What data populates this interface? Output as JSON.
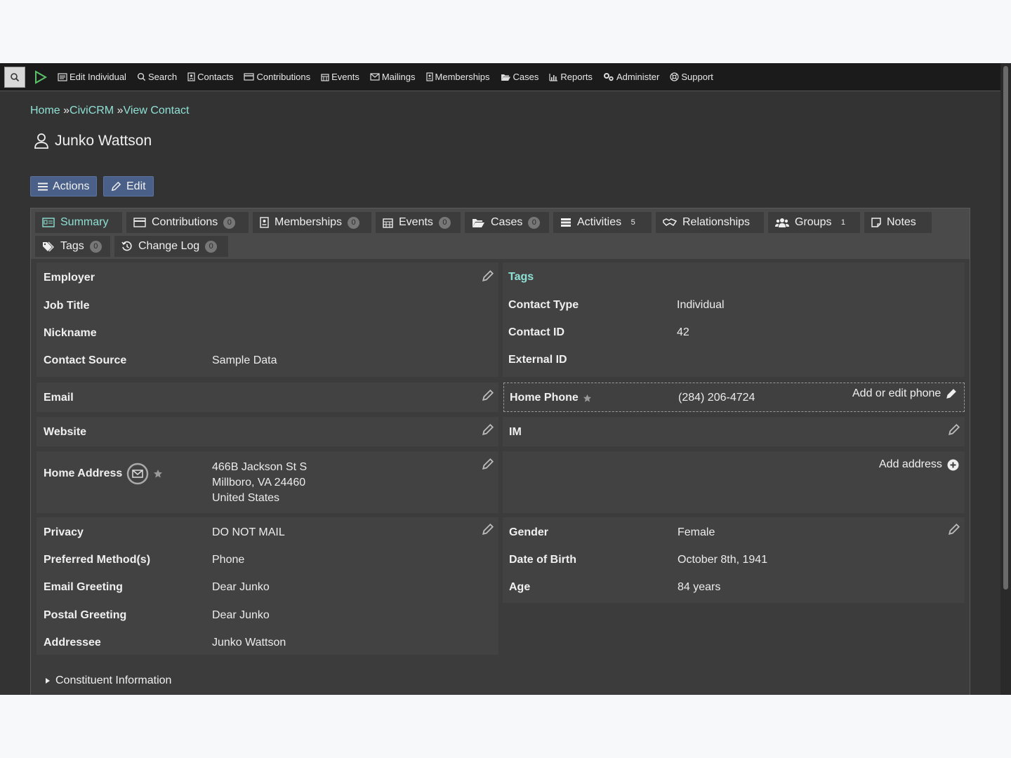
{
  "menubar": {
    "items": [
      {
        "label": "Edit Individual",
        "icon": "address-card-icon"
      },
      {
        "label": "Search",
        "icon": "search-icon"
      },
      {
        "label": "Contacts",
        "icon": "contact-book-icon"
      },
      {
        "label": "Contributions",
        "icon": "credit-card-icon"
      },
      {
        "label": "Events",
        "icon": "calendar-icon"
      },
      {
        "label": "Mailings",
        "icon": "envelope-icon"
      },
      {
        "label": "Memberships",
        "icon": "id-badge-icon"
      },
      {
        "label": "Cases",
        "icon": "folder-open-icon"
      },
      {
        "label": "Reports",
        "icon": "bar-chart-icon"
      },
      {
        "label": "Administer",
        "icon": "cogs-icon"
      },
      {
        "label": "Support",
        "icon": "life-ring-icon"
      }
    ]
  },
  "breadcrumb": {
    "home": "Home",
    "sep1": " »",
    "civicrm": "CiviCRM",
    "sep2": " »",
    "view": "View Contact"
  },
  "contact": {
    "name": "Junko Wattson"
  },
  "buttons": {
    "actions": "Actions",
    "edit": "Edit"
  },
  "tabs": [
    {
      "label": "Summary",
      "badge": ""
    },
    {
      "label": "Contributions",
      "badge": "0"
    },
    {
      "label": "Memberships",
      "badge": "0"
    },
    {
      "label": "Events",
      "badge": "0"
    },
    {
      "label": "Cases",
      "badge": "0"
    },
    {
      "label": "Activities",
      "badge": "5"
    },
    {
      "label": "Relationships",
      "badge": ""
    },
    {
      "label": "Groups",
      "badge": "1"
    },
    {
      "label": "Notes",
      "badge": ""
    },
    {
      "label": "Tags",
      "badge": "0"
    },
    {
      "label": "Change Log",
      "badge": "0"
    }
  ],
  "left": {
    "employer": "Employer",
    "job_title": "Job Title",
    "nickname": "Nickname",
    "contact_source": "Contact Source",
    "contact_source_value": "Sample Data",
    "email": "Email",
    "website": "Website",
    "home_address": "Home Address",
    "address_lines": [
      "466B Jackson St S",
      "Millboro, VA 24460",
      "United States"
    ],
    "privacy": "Privacy",
    "privacy_value": "DO NOT MAIL",
    "preferred_methods": "Preferred Method(s)",
    "preferred_methods_value": "Phone",
    "email_greeting": "Email Greeting",
    "email_greeting_value": "Dear Junko",
    "postal_greeting": "Postal Greeting",
    "postal_greeting_value": "Dear Junko",
    "addressee": "Addressee",
    "addressee_value": "Junko Wattson",
    "constituent_info": "Constituent Information"
  },
  "right": {
    "tags": "Tags",
    "contact_type": "Contact Type",
    "contact_type_value": "Individual",
    "contact_id": "Contact ID",
    "contact_id_value": "42",
    "external_id": "External ID",
    "home_phone": "Home Phone",
    "home_phone_value": "(284) 206-4724",
    "add_edit_phone": "Add or edit phone",
    "im": "IM",
    "add_address": "Add address",
    "gender": "Gender",
    "gender_value": "Female",
    "dob": "Date of Birth",
    "dob_value": "October 8th, 1941",
    "age": "Age",
    "age_value": "84 years"
  },
  "colors": {
    "accent": "#8ee0d4",
    "button": "#4a6088",
    "background": "#333333"
  }
}
